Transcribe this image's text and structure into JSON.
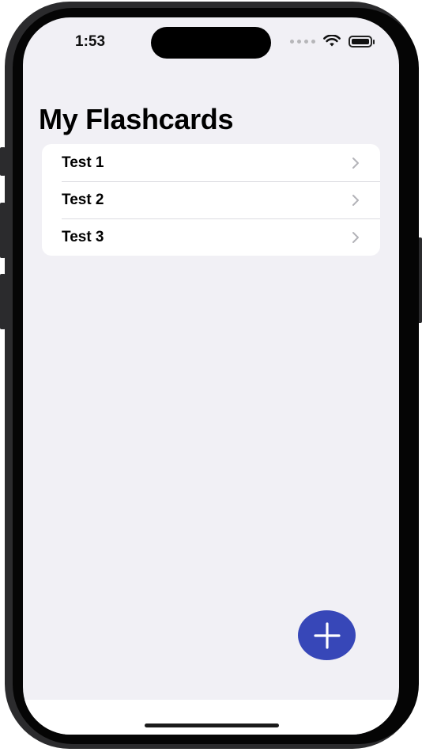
{
  "status_bar": {
    "time": "1:53"
  },
  "page": {
    "title": "My Flashcards"
  },
  "list": {
    "items": [
      {
        "label": "Test 1"
      },
      {
        "label": "Test 2"
      },
      {
        "label": "Test 3"
      }
    ]
  },
  "fab": {
    "icon": "plus-icon",
    "color": "#3747b8"
  },
  "colors": {
    "background": "#f1f0f5",
    "card": "#ffffff",
    "chevron": "#b3b3b8"
  }
}
